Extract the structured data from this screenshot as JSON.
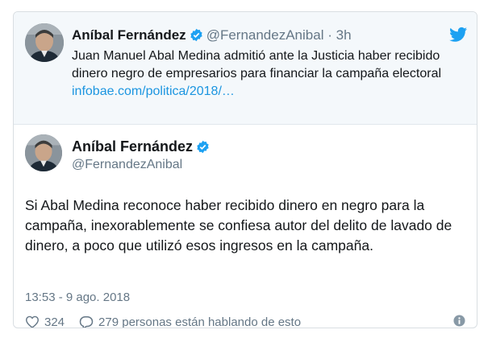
{
  "parent_tweet": {
    "author_name": "Aníbal Fernández",
    "handle": "@FernandezAnibal",
    "separator": "·",
    "time": "3h",
    "text": "Juan Manuel Abal Medina admitió ante la Justicia haber recibido dinero negro de empresarios para financiar la campaña electoral",
    "link": "infobae.com/politica/2018/…",
    "icons": {
      "avatar": "avatar",
      "verified": "verified-badge-icon",
      "brand": "twitter-bird-icon"
    }
  },
  "main_tweet": {
    "author_name": "Aníbal Fernández",
    "handle": "@FernandezAnibal",
    "text": "Si Abal Medina reconoce haber recibido dinero en negro para la campaña, inexorablemente se confiesa autor del delito de lavado de dinero, a poco que utilizó esos ingresos en la campaña.",
    "timestamp": "13:53 - 9 ago. 2018",
    "likes": "324",
    "conversation": "279 personas están hablando de esto",
    "icons": {
      "like": "heart-icon",
      "reply": "speech-bubble-icon",
      "info": "info-icon"
    }
  },
  "colors": {
    "accent": "#1da1f2",
    "link": "#1b95e0",
    "muted": "#657786",
    "parent_background": "#f4f8fb"
  }
}
